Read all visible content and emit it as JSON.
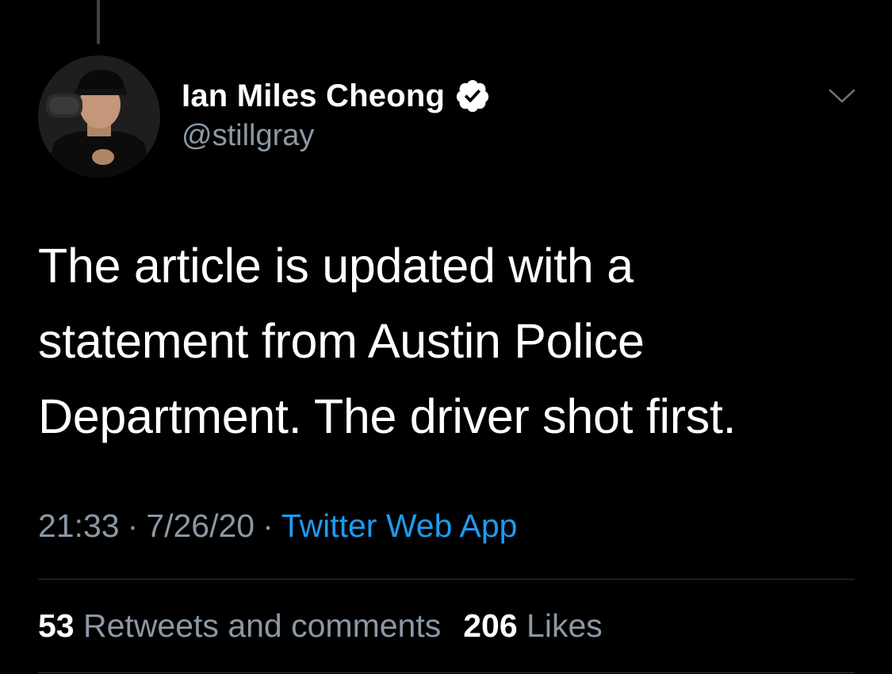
{
  "tweet": {
    "author": {
      "display_name": "Ian Miles Cheong",
      "handle": "@stillgray",
      "verified": true,
      "avatar_icon": "profile-photo"
    },
    "text_lines": [
      "The article is updated with a",
      "statement from Austin Police",
      "Department. The driver shot first."
    ],
    "time": "21:33",
    "date": "7/26/20",
    "separator": "·",
    "source": "Twitter Web App",
    "stats": {
      "retweets_count": "53",
      "retweets_label": "Retweets and comments",
      "likes_count": "206",
      "likes_label": "Likes"
    }
  },
  "icons": {
    "verified": "verified-badge-icon",
    "more": "chevron-down-icon"
  },
  "colors": {
    "background": "#000000",
    "primary_text": "#ffffff",
    "secondary_text": "#8b98a5",
    "link": "#1d9bf0",
    "divider": "#2f3336"
  }
}
